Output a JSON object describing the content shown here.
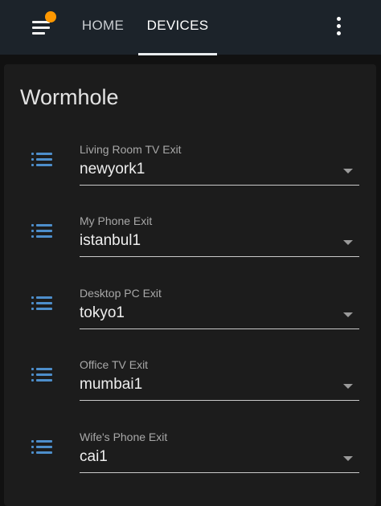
{
  "header": {
    "menu_icon": "menu-icon",
    "notification_dot_color": "#ff9800",
    "tabs": [
      {
        "label": "HOME",
        "active": false
      },
      {
        "label": "DEVICES",
        "active": true
      }
    ],
    "overflow_icon": "more-vert-icon"
  },
  "card": {
    "title": "Wormhole",
    "rows": [
      {
        "label": "Living Room TV Exit",
        "value": "newyork1"
      },
      {
        "label": "My Phone Exit",
        "value": "istanbul1"
      },
      {
        "label": "Desktop PC Exit",
        "value": "tokyo1"
      },
      {
        "label": "Office TV Exit",
        "value": "mumbai1"
      },
      {
        "label": "Wife's Phone Exit",
        "value": "cai1"
      }
    ],
    "row_icon": "format-list-bulleted-icon",
    "accent_color": "#4d8ecb"
  }
}
